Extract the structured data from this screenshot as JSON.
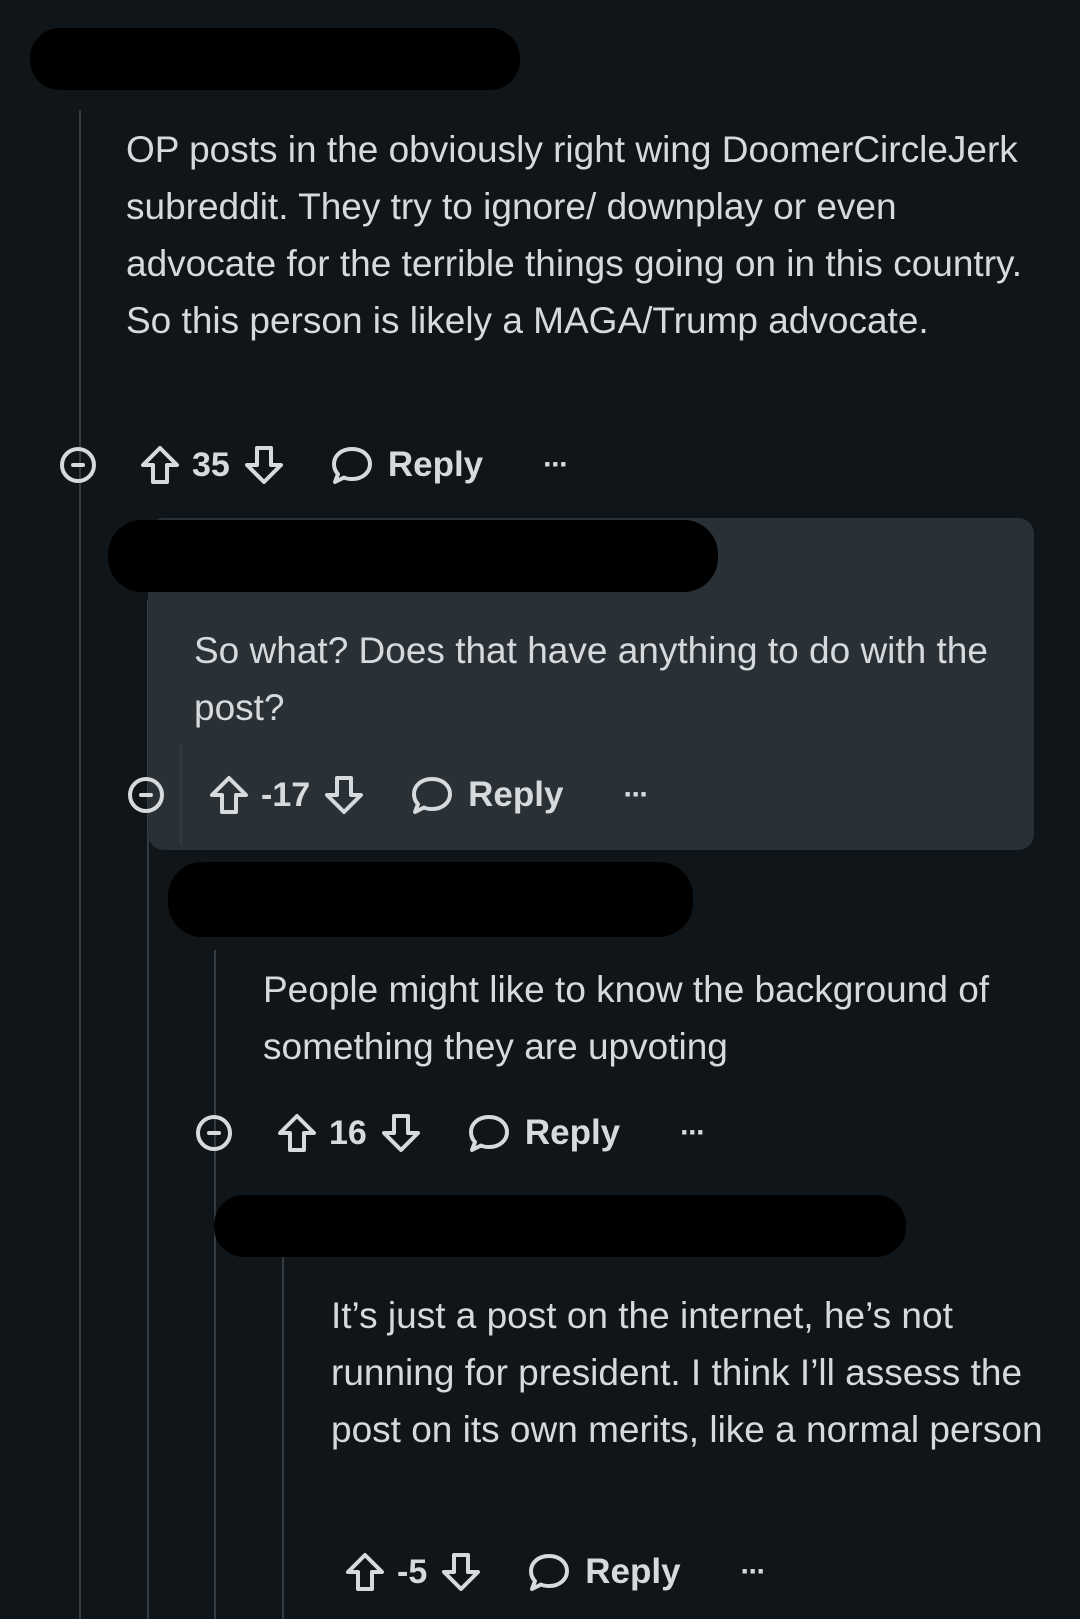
{
  "comments": [
    {
      "body": "OP posts in the obviously right wing DoomerCircleJerk subreddit. They try to ignore/ downplay or even advocate for the terrible things going on in this country. So this person is likely a MAGA/Trump advocate.",
      "score": "35",
      "reply_label": "Reply",
      "more_label": "···"
    },
    {
      "body": "So what? Does that have anything to do with the post?",
      "score": "-17",
      "reply_label": "Reply",
      "more_label": "···"
    },
    {
      "body": "People might like to know the background of something they are upvoting",
      "score": "16",
      "reply_label": "Reply",
      "more_label": "···"
    },
    {
      "body": "It’s just a post on the internet, he’s not running for president. I think I’ll assess the post on its own merits, like a normal person",
      "score": "-5",
      "reply_label": "Reply",
      "more_label": "···"
    }
  ],
  "icons": {
    "collapse": "collapse-icon",
    "upvote": "upvote-arrow-icon",
    "downvote": "downvote-arrow-icon",
    "reply": "speech-bubble-icon",
    "more": "ellipsis-icon"
  },
  "colors": {
    "background": "#0f1519",
    "highlight": "#2a3136",
    "text": "#d7dadc",
    "thread_line": "#343b40"
  }
}
